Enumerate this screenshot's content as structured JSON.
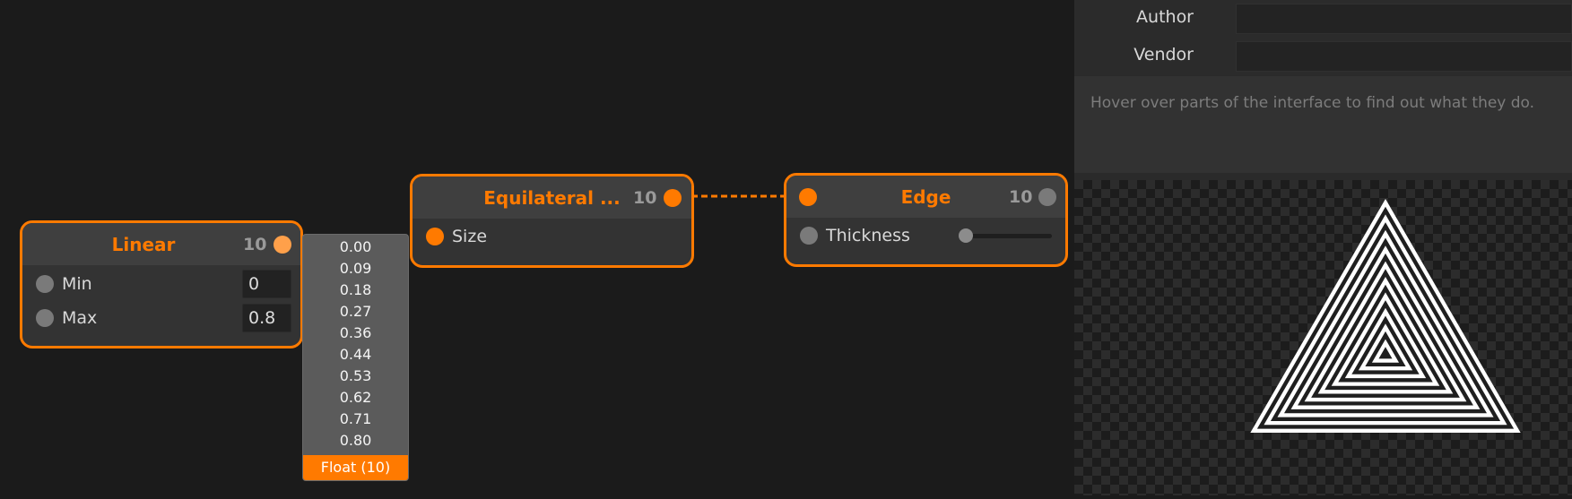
{
  "nodes": {
    "linear": {
      "title": "Linear",
      "count": "10",
      "inputs": [
        {
          "label": "Min",
          "value": "0"
        },
        {
          "label": "Max",
          "value": "0.8"
        }
      ]
    },
    "equilateral": {
      "title": "Equilateral ...",
      "count": "10",
      "inputs": [
        {
          "label": "Size"
        }
      ]
    },
    "edge": {
      "title": "Edge",
      "count": "10",
      "inputs": [
        {
          "label": "Thickness",
          "slider_fraction": 0.0
        }
      ]
    }
  },
  "value_popup": {
    "values": [
      "0.00",
      "0.09",
      "0.18",
      "0.27",
      "0.36",
      "0.44",
      "0.53",
      "0.62",
      "0.71",
      "0.80"
    ],
    "footer": "Float (10)"
  },
  "side_panel": {
    "author_label": "Author",
    "author_value": "",
    "vendor_label": "Vendor",
    "vendor_value": "",
    "hint": "Hover over parts of the interface to find out what they do."
  },
  "preview": {
    "shape": "concentric-equilateral-triangles",
    "ring_count": 10
  },
  "colors": {
    "accent": "#ff7a00",
    "background": "#1b1b1b",
    "node_body": "#333333",
    "node_header": "#3f3f3f"
  }
}
